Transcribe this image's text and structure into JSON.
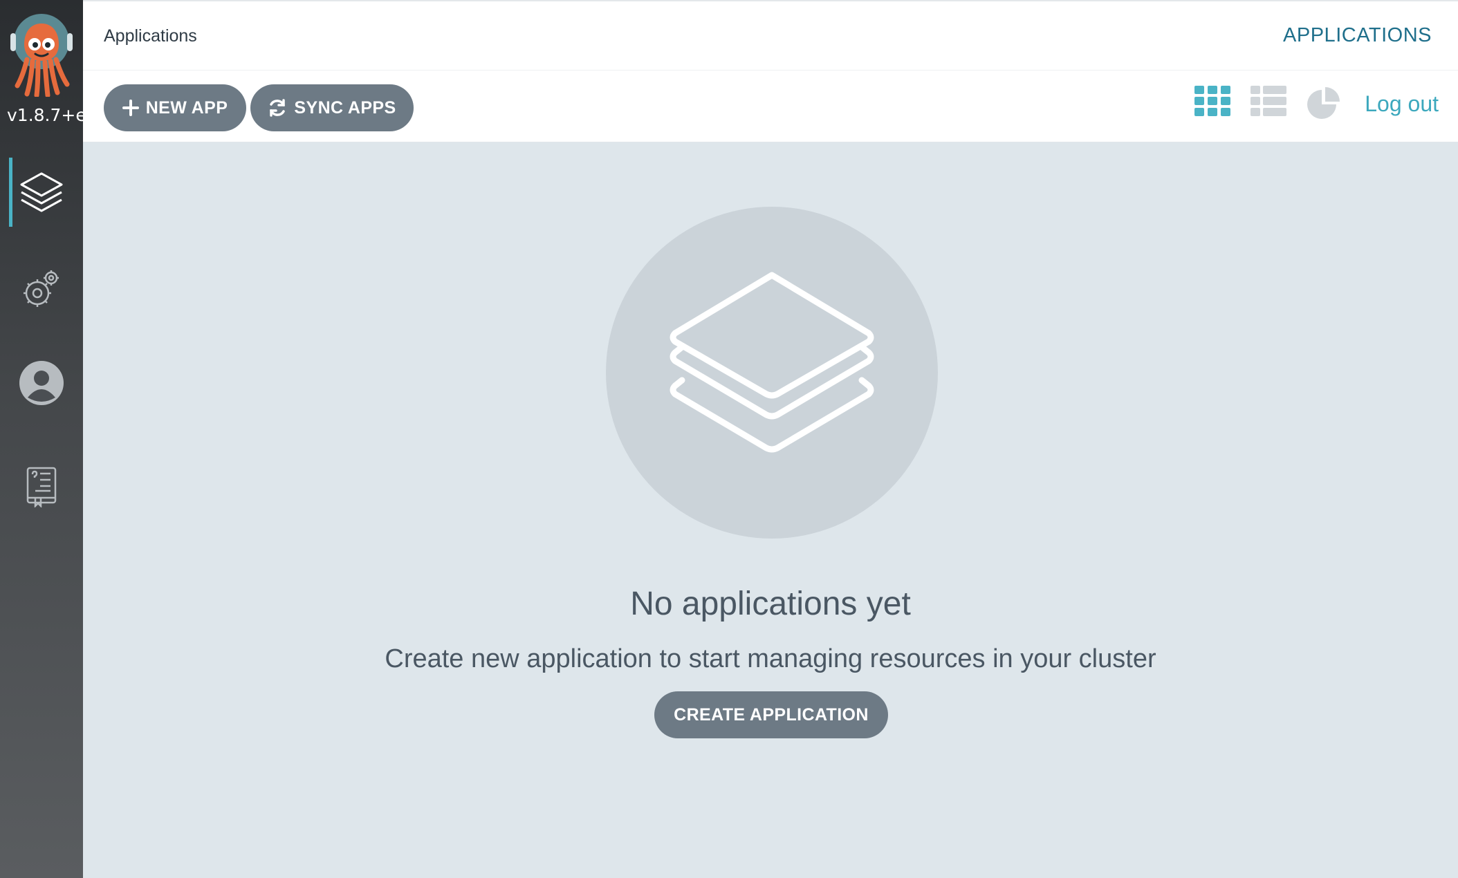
{
  "sidebar": {
    "logo_icon": "argo-octopus-logo",
    "version": "v1.8.7+e",
    "items": [
      {
        "name": "applications",
        "icon": "layers-icon",
        "active": true
      },
      {
        "name": "settings",
        "icon": "gears-icon",
        "active": false
      },
      {
        "name": "user-info",
        "icon": "user-icon",
        "active": false
      },
      {
        "name": "documentation",
        "icon": "docs-icon",
        "active": false
      }
    ],
    "accent_color": "#4ab3c6"
  },
  "header": {
    "title": "Applications",
    "nav_link": "APPLICATIONS"
  },
  "toolbar": {
    "new_app_label": "NEW APP",
    "sync_apps_label": "SYNC APPS",
    "view_modes": [
      {
        "name": "tiles",
        "icon": "grid-icon",
        "active": true
      },
      {
        "name": "list",
        "icon": "list-icon",
        "active": false
      },
      {
        "name": "summary",
        "icon": "pie-chart-icon",
        "active": false
      }
    ],
    "logout_label": "Log out"
  },
  "empty_state": {
    "icon": "layers-icon",
    "title": "No applications yet",
    "subtitle": "Create new application to start managing resources in your cluster",
    "button_label": "CREATE APPLICATION"
  },
  "colors": {
    "button_bg": "#6d7a85",
    "link": "#3ca8bd",
    "background": "#dee6eb"
  }
}
